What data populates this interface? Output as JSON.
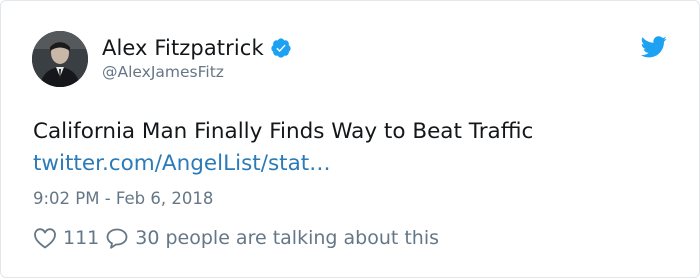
{
  "author": {
    "display_name": "Alex Fitzpatrick",
    "handle": "@AlexJamesFitz",
    "verified_icon": "verified-badge-icon",
    "avatar_icon": "profile-photo"
  },
  "tweet": {
    "text": "California Man Finally Finds Way to Beat Traffic",
    "link_text": "twitter.com/AngelList/stat…",
    "timestamp": "9:02 PM - Feb 6, 2018"
  },
  "actions": {
    "like_icon": "heart-icon",
    "like_count": "111",
    "reply_icon": "speech-bubble-icon",
    "talking_text": "30 people are talking about this"
  },
  "brand": {
    "icon": "twitter-bird-icon",
    "color": "#1da1f2",
    "link_color": "#2b7bb9",
    "secondary_text_color": "#657786"
  }
}
